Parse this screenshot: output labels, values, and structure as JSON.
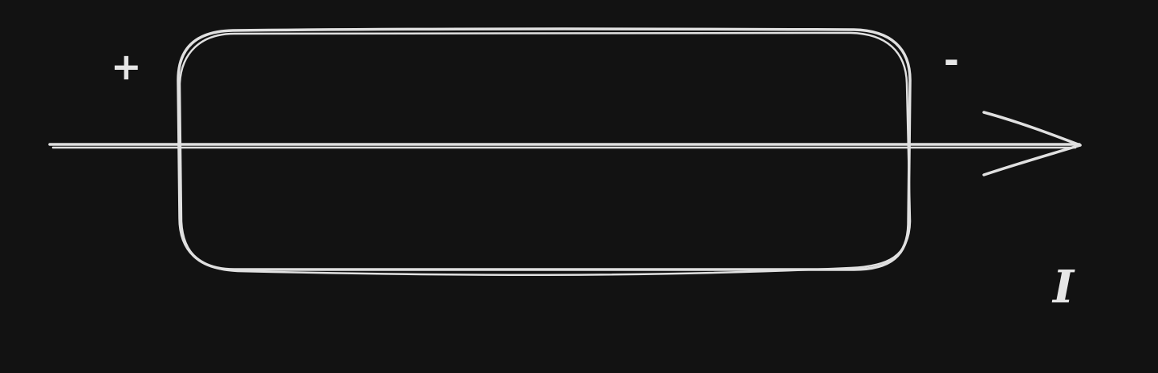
{
  "diagram": {
    "positive_terminal": "+",
    "negative_terminal": "-",
    "current_label": "I",
    "stroke_color": "#e6e6e6",
    "background_color": "#121212"
  }
}
